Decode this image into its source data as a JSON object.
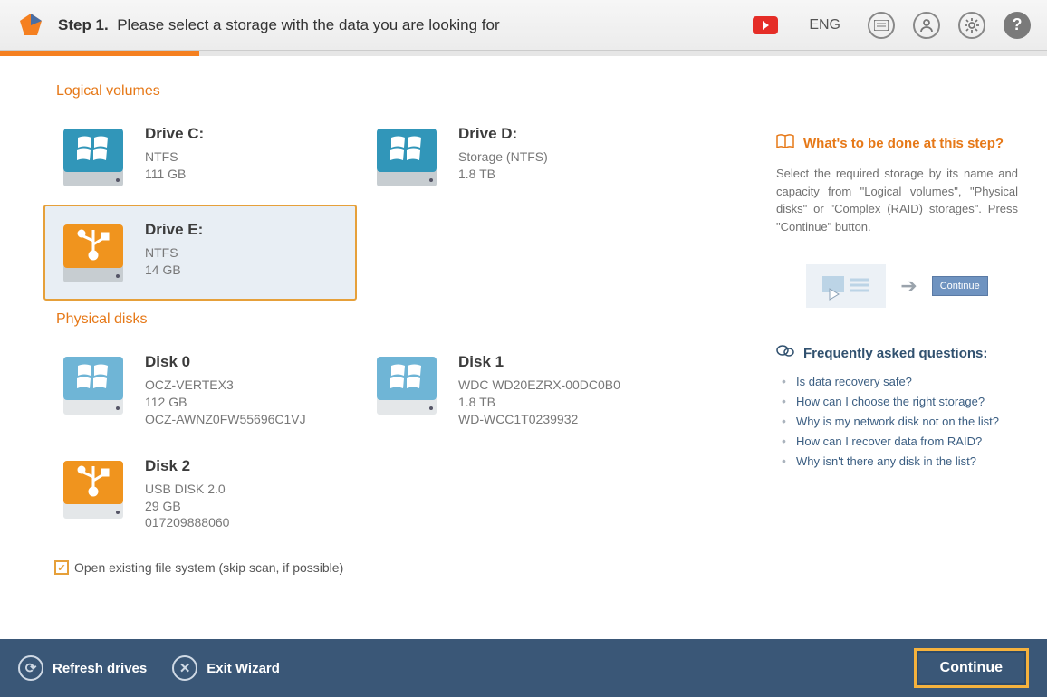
{
  "header": {
    "step_prefix": "Step 1.",
    "step_text": "Please select a storage with the data you are looking for",
    "lang": "ENG"
  },
  "sections": {
    "logical": "Logical volumes",
    "physical": "Physical disks"
  },
  "logical": [
    {
      "name": "Drive C:",
      "fs": "NTFS",
      "size": "111 GB",
      "iconStyle": "win"
    },
    {
      "name": "Drive D:",
      "fs": "Storage (NTFS)",
      "size": "1.8 TB",
      "iconStyle": "win"
    },
    {
      "name": "Drive E:",
      "fs": "NTFS",
      "size": "14 GB",
      "iconStyle": "usb",
      "selected": true
    }
  ],
  "physical": [
    {
      "name": "Disk 0",
      "model": "OCZ-VERTEX3",
      "size": "112 GB",
      "serial": "OCZ-AWNZ0FW55696C1VJ",
      "iconStyle": "winlight"
    },
    {
      "name": "Disk 1",
      "model": "WDC WD20EZRX-00DC0B0",
      "size": "1.8 TB",
      "serial": "WD-WCC1T0239932",
      "iconStyle": "winlight"
    },
    {
      "name": "Disk 2",
      "model": "USB DISK 2.0",
      "size": "29 GB",
      "serial": "017209888060",
      "iconStyle": "usblight"
    }
  ],
  "openExisting": "Open existing file system (skip scan, if possible)",
  "panel": {
    "title": "What's to be done at this step?",
    "text": "Select the required storage by its name and capacity from \"Logical volumes\", \"Physical disks\" or \"Complex (RAID) storages\". Press \"Continue\" button.",
    "illus_btn": "Continue"
  },
  "faq": {
    "title": "Frequently asked questions:",
    "items": [
      "Is data recovery safe?",
      "How can I choose the right storage?",
      "Why is my network disk not on the list?",
      "How can I recover data from RAID?",
      "Why isn't there any disk in the list?"
    ]
  },
  "footer": {
    "refresh": "Refresh drives",
    "exit": "Exit Wizard",
    "continue": "Continue"
  }
}
